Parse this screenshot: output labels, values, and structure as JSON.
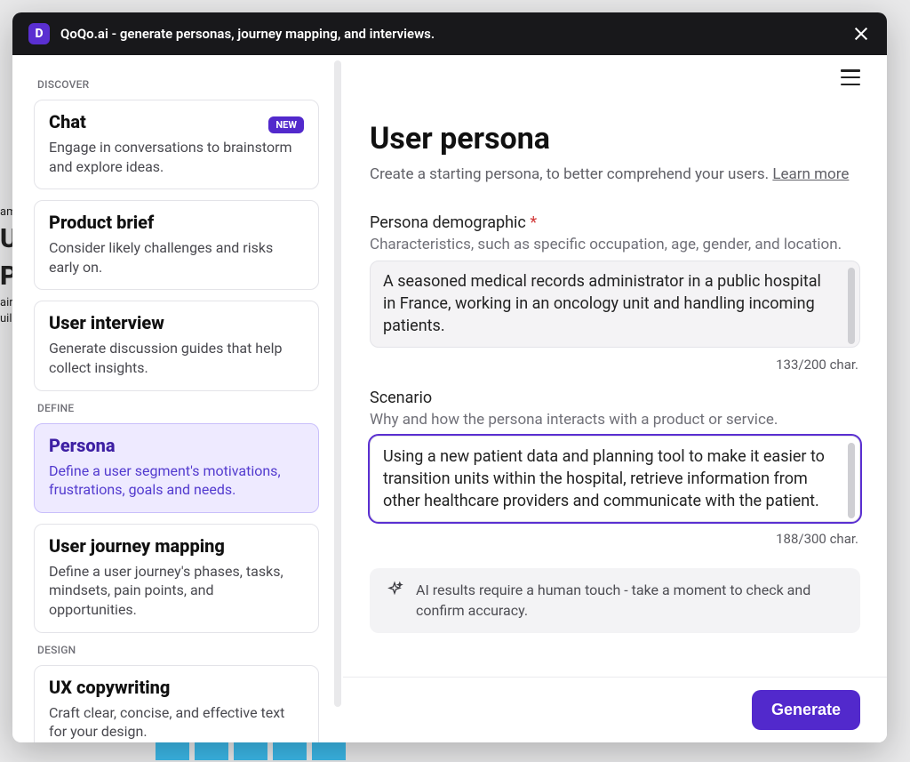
{
  "header": {
    "logo_letter": "D",
    "title": "QoQo.ai - generate personas, journey mapping, and interviews."
  },
  "sidebar": {
    "sections": [
      {
        "label": "DISCOVER",
        "items": [
          {
            "title": "Chat",
            "desc": "Engage in conversations to brainstorm and explore ideas.",
            "badge": "NEW"
          },
          {
            "title": "Product brief",
            "desc": "Consider likely challenges and risks early on."
          },
          {
            "title": "User interview",
            "desc": "Generate discussion guides that help collect insights."
          }
        ]
      },
      {
        "label": "DEFINE",
        "items": [
          {
            "title": "Persona",
            "desc": "Define a user segment's motivations, frustrations, goals and needs.",
            "active": true
          },
          {
            "title": "User journey mapping",
            "desc": "Define a user journey's phases, tasks, mindsets, pain points, and opportunities."
          }
        ]
      },
      {
        "label": "DESIGN",
        "items": [
          {
            "title": "UX copywriting",
            "desc": "Craft clear, concise, and effective text for your design."
          }
        ]
      }
    ]
  },
  "main": {
    "heading": "User persona",
    "subtitle_prefix": "Create a starting persona, to better comprehend your users. ",
    "learn_more": "Learn more",
    "fields": {
      "demographic": {
        "label": "Persona demographic",
        "required": true,
        "help": "Characteristics, such as specific occupation, age, gender, and location.",
        "value": "A seasoned medical records administrator in a public hospital in France, working in an oncology unit and handling incoming patients.",
        "counter": "133/200 char."
      },
      "scenario": {
        "label": "Scenario",
        "required": false,
        "help": "Why and how the persona interacts with a product or service.",
        "value": "Using a new patient data and planning tool to make it easier to transition units within the hospital, retrieve information from other healthcare providers and communicate with the patient.",
        "counter": "188/300 char."
      }
    },
    "notice": "AI results require a human touch - take a moment to check and confirm accuracy."
  },
  "footer": {
    "generate": "Generate"
  }
}
